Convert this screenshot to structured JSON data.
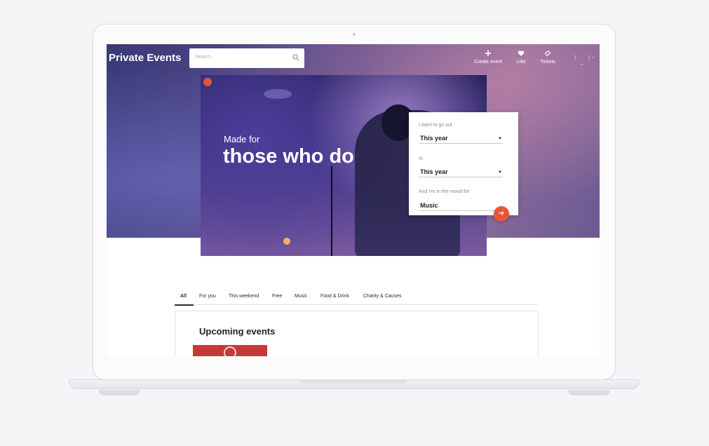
{
  "app": {
    "brand": "Private Events"
  },
  "search": {
    "placeholder": "Search..."
  },
  "nav": {
    "create_label": "Create event",
    "like_label": "Like",
    "tickets_label": "Tickets"
  },
  "hero": {
    "subtitle": "Made for",
    "title": "those who do"
  },
  "filters": {
    "when_label": "I want to go out",
    "when_value": "This year",
    "where_label": "In",
    "where_value": "This year",
    "mood_label": "And I'm in the mood for",
    "mood_value": "Music",
    "submit_icon": "arrow-right-icon"
  },
  "tabs": [
    {
      "label": "All",
      "active": true
    },
    {
      "label": "For you"
    },
    {
      "label": "This weekend"
    },
    {
      "label": "Free"
    },
    {
      "label": "Music"
    },
    {
      "label": "Food & Drink"
    },
    {
      "label": "Charity & Causes"
    }
  ],
  "upcoming": {
    "title": "Upcoming events"
  },
  "colors": {
    "accent": "#e8553b",
    "hero": "#4a3f86",
    "thumb": "#c43a3a"
  }
}
